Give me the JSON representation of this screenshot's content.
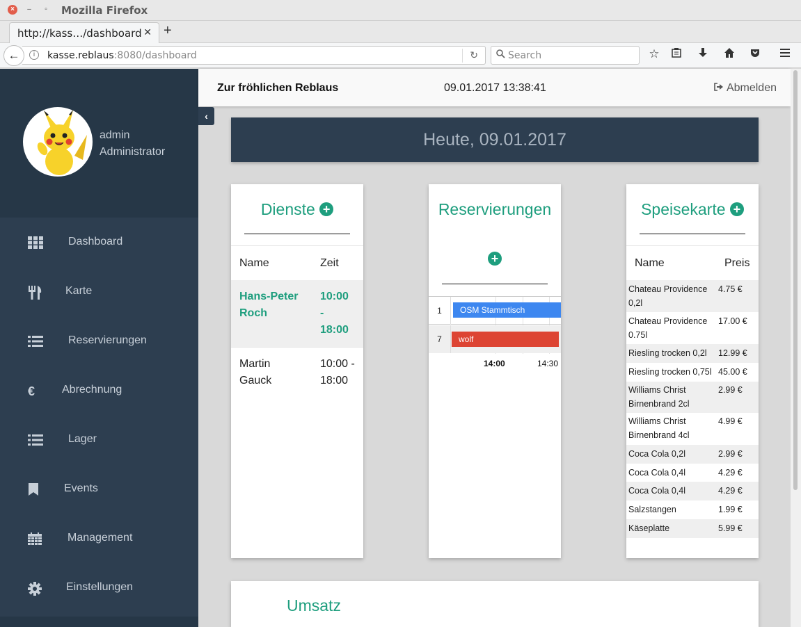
{
  "browser": {
    "window_title": "Mozilla Firefox",
    "tab_title": "http://kass…/dashboard",
    "url_host": "kasse.reblaus",
    "url_rest": ":8080/dashboard",
    "search_placeholder": "Search"
  },
  "header": {
    "brand": "Zur fröhlichen Reblaus",
    "datetime": "09.01.2017 13:38:41",
    "logout_label": "Abmelden"
  },
  "user": {
    "name": "admin",
    "role": "Administrator"
  },
  "sidebar": {
    "items": [
      {
        "label": "Dashboard",
        "icon": "grid-icon"
      },
      {
        "label": "Karte",
        "icon": "cutlery-icon"
      },
      {
        "label": "Reservierungen",
        "icon": "list-icon"
      },
      {
        "label": "Abrechnung",
        "icon": "euro-icon"
      },
      {
        "label": "Lager",
        "icon": "list-icon"
      },
      {
        "label": "Events",
        "icon": "bookmark-icon"
      },
      {
        "label": "Management",
        "icon": "calendar-icon"
      },
      {
        "label": "Einstellungen",
        "icon": "gear-icon"
      }
    ]
  },
  "today": "Heute, 09.01.2017",
  "dienste": {
    "title": "Dienste",
    "col_name": "Name",
    "col_time": "Zeit",
    "rows": [
      {
        "name_l1": "Hans-Peter",
        "name_l2": "Roch",
        "time_l1": "10:00",
        "time_l2": "-",
        "time_l3": "18:00"
      },
      {
        "name_l1": "Martin",
        "name_l2": "Gauck",
        "time_l1": "10:00 -",
        "time_l2": "18:00"
      }
    ]
  },
  "reservierungen": {
    "title": "Reservierungen",
    "rows": [
      {
        "table": "1",
        "label": "OSM Stammtisch",
        "color": "#3d87f0"
      },
      {
        "table": "7",
        "label": "wolf",
        "color": "#dd4433"
      }
    ],
    "times": [
      "14:00",
      "14:30"
    ]
  },
  "speisekarte": {
    "title": "Speisekarte",
    "col_name": "Name",
    "col_price": "Preis",
    "items": [
      {
        "name_l1": "Chateau Providence",
        "name_l2": "0,2l",
        "price": "4.75 €"
      },
      {
        "name_l1": "Chateau Providence",
        "name_l2": "0.75l",
        "price": "17.00 €"
      },
      {
        "name_l1": "Riesling trocken 0,2l",
        "name_l2": "",
        "price": "12.99 €"
      },
      {
        "name_l1": "Riesling trocken 0,75l",
        "name_l2": "",
        "price": "45.00 €"
      },
      {
        "name_l1": "Williams Christ",
        "name_l2": "Birnenbrand 2cl",
        "price": "2.99 €"
      },
      {
        "name_l1": "Williams Christ",
        "name_l2": "Birnenbrand 4cl",
        "price": "4.99 €"
      },
      {
        "name_l1": "Coca Cola 0,2l",
        "name_l2": "",
        "price": "2.99 €"
      },
      {
        "name_l1": "Coca Cola 0,4l",
        "name_l2": "",
        "price": "4.29 €"
      },
      {
        "name_l1": "Coca Cola 0,4l",
        "name_l2": "",
        "price": "4.29 €"
      },
      {
        "name_l1": "Salzstangen",
        "name_l2": "",
        "price": "1.99 €"
      },
      {
        "name_l1": "Käseplatte",
        "name_l2": "",
        "price": "5.99 €"
      }
    ]
  },
  "umsatz": {
    "title": "Umsatz"
  },
  "colors": {
    "accent": "#1e9e7e",
    "sidebar": "#2d3e50"
  }
}
